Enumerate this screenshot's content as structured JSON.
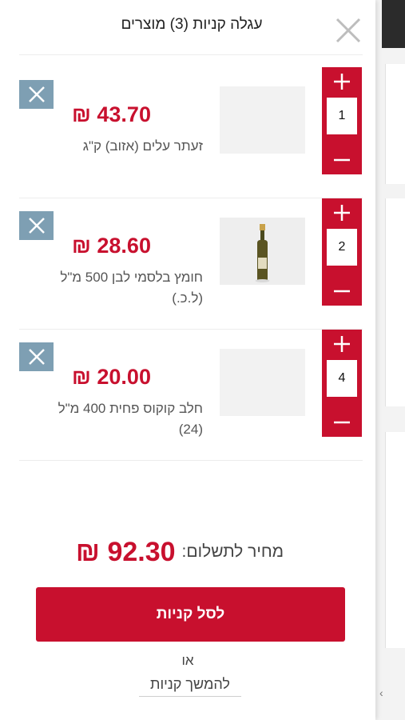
{
  "header": {
    "title": "עגלה קניות (3) מוצרים"
  },
  "currency_symbol": "₪",
  "items": [
    {
      "price": "43.70",
      "name": "זעתר עלים (אזוב) ק\"ג",
      "quantity": "1",
      "has_image": false
    },
    {
      "price": "28.60",
      "name": "חומץ בלסמי לבן 500 מ\"ל (ל.כ.)",
      "quantity": "2",
      "has_image": true
    },
    {
      "price": "20.00",
      "name": "חלב קוקוס פחית 400 מ\"ל (24)",
      "quantity": "4",
      "has_image": false
    }
  ],
  "summary": {
    "label": "מחיר לתשלום:",
    "total": "92.30"
  },
  "checkout": {
    "label": "לסל קניות"
  },
  "or_text": "או",
  "continue_label": "להמשך קניות",
  "colors": {
    "accent": "#c8102e",
    "remove": "#7e9fb3"
  }
}
